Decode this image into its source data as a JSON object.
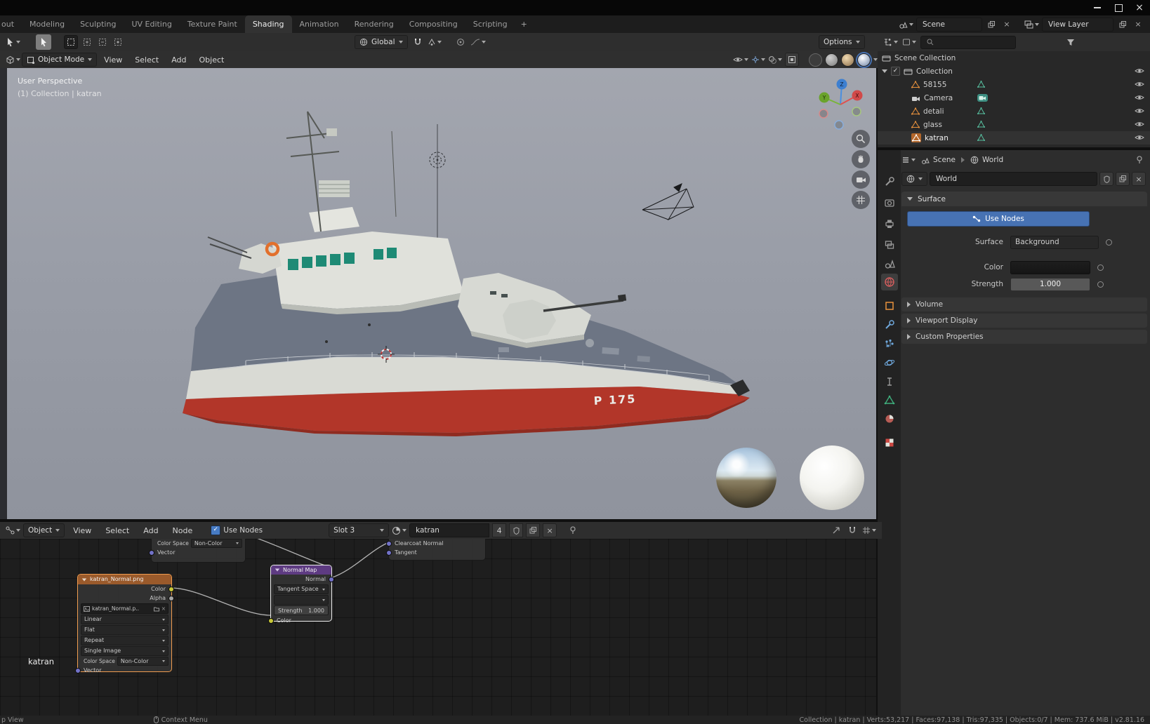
{
  "colors": {
    "accent": "#4772b3",
    "node_texture_header": "#9a5a2b",
    "node_vector_header": "#5e3b82"
  },
  "topbar": {
    "tabs": [
      "out",
      "Modeling",
      "Sculpting",
      "UV Editing",
      "Texture Paint",
      "Shading",
      "Animation",
      "Rendering",
      "Compositing",
      "Scripting"
    ],
    "active_tab": "Shading",
    "add_tab": "+",
    "scene_label": "Scene",
    "view_layer_label": "View Layer"
  },
  "tool_settings": {
    "orientation": "Global",
    "options": "Options"
  },
  "viewport": {
    "mode": "Object Mode",
    "menus": [
      "View",
      "Select",
      "Add",
      "Object"
    ],
    "overlay_line1": "User Perspective",
    "overlay_line2": "(1) Collection | katran",
    "gizmo": {
      "x": "X",
      "y": "Y",
      "z": "Z"
    },
    "boat_marking": "P 175"
  },
  "outliner": {
    "scene_collection": "Scene Collection",
    "collection": "Collection",
    "items": [
      {
        "name": "58155",
        "type": "mesh"
      },
      {
        "name": "Camera",
        "type": "camera"
      },
      {
        "name": "detali",
        "type": "mesh"
      },
      {
        "name": "glass",
        "type": "mesh"
      },
      {
        "name": "katran",
        "type": "mesh",
        "active": true
      }
    ]
  },
  "properties": {
    "breadcrumb": {
      "scene": "Scene",
      "world": "World"
    },
    "world_field": "World",
    "surface_panel": "Surface",
    "use_nodes": "Use Nodes",
    "rows": {
      "surface_label": "Surface",
      "surface_value": "Background",
      "color_label": "Color",
      "strength_label": "Strength",
      "strength_value": "1.000"
    },
    "collapsed_panels": [
      "Volume",
      "Viewport Display",
      "Custom Properties"
    ]
  },
  "shader": {
    "header": {
      "type": "Object",
      "menus": [
        "View",
        "Select",
        "Add",
        "Node"
      ],
      "use_nodes": "Use Nodes",
      "slot": "Slot 3",
      "material": "katran",
      "users": "4"
    },
    "node_partial_top": {
      "color_space_label": "Color Space",
      "color_space_value": "Non-Color",
      "vector": "Vector"
    },
    "node_partial_right": {
      "row1": "Clearcoat Normal",
      "row2": "Tangent"
    },
    "image_node": {
      "title": "katran_Normal.png",
      "out_color": "Color",
      "out_alpha": "Alpha",
      "image": "katran_Normal.p..",
      "interpolation": "Linear",
      "projection": "Flat",
      "extension": "Repeat",
      "source": "Single Image",
      "color_space_label": "Color Space",
      "color_space_value": "Non-Color",
      "in_vector": "Vector"
    },
    "normal_node": {
      "title": "Normal Map",
      "out": "Normal",
      "space": "Tangent Space",
      "strength_label": "Strength",
      "strength_value": "1.000",
      "in_color": "Color"
    },
    "float_label": "katran"
  },
  "statusbar": {
    "left_partial": "p View",
    "hint": "Context Menu",
    "stats": "Collection | katran | Verts:53,217 | Faces:97,138 | Tris:97,335 | Objects:0/7 | Mem: 737.6 MiB | v2.81.16"
  }
}
